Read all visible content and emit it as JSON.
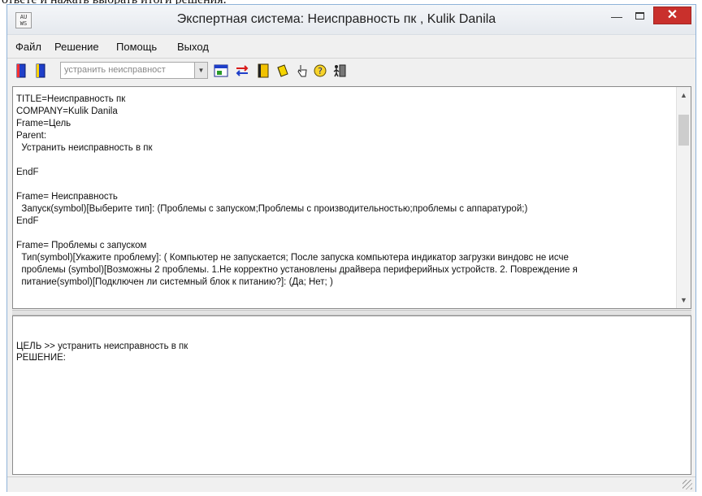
{
  "top_fragment": "ответе и нажать выбрать итоги решения.",
  "window": {
    "title": "Экспертная система: Неисправность пк , Kulik Danila",
    "icon_text": "AU\nWS"
  },
  "menu": [
    "Файл",
    "Решение",
    "Помощь",
    "Выход"
  ],
  "toolbar": {
    "combo_value": "устранить неисправност",
    "icons": [
      "book-blue-icon",
      "book-blue-icon",
      "window-icon",
      "swap-arrows-icon",
      "notebook-icon",
      "yellow-book-icon",
      "pointer-hand-icon",
      "help-icon",
      "exit-person-icon"
    ]
  },
  "editor": {
    "lines": [
      "TITLE=Неисправность пк",
      "COMPANY=Kulik Danila",
      "Frame=Цель",
      "Parent:",
      "  Устранить неисправность в пк",
      "",
      "EndF",
      "",
      "Frame= Неисправность",
      "  Запуск(symbol)[Выберите тип]: (Проблемы с запуском;Проблемы с производительностью;проблемы с аппаратурой;)",
      "EndF",
      "",
      "Frame= Проблемы с запуском",
      "  Тип(symbol)[Укажите проблему]: ( Компьютер не запускается; После запуска компьютера индикатор загрузки виндовс не исче",
      "  проблемы (symbol)[Возможны 2 проблемы. 1.Не корректно установлены драйвера периферийных устройств. 2. Повреждение я",
      "  питание(symbol)[Подключен ли системный блок к питанию?]: (Да; Нет; )"
    ]
  },
  "output": {
    "lines": [
      "ЦЕЛЬ >> устранить неисправность в пк",
      "РЕШЕНИЕ:"
    ]
  }
}
